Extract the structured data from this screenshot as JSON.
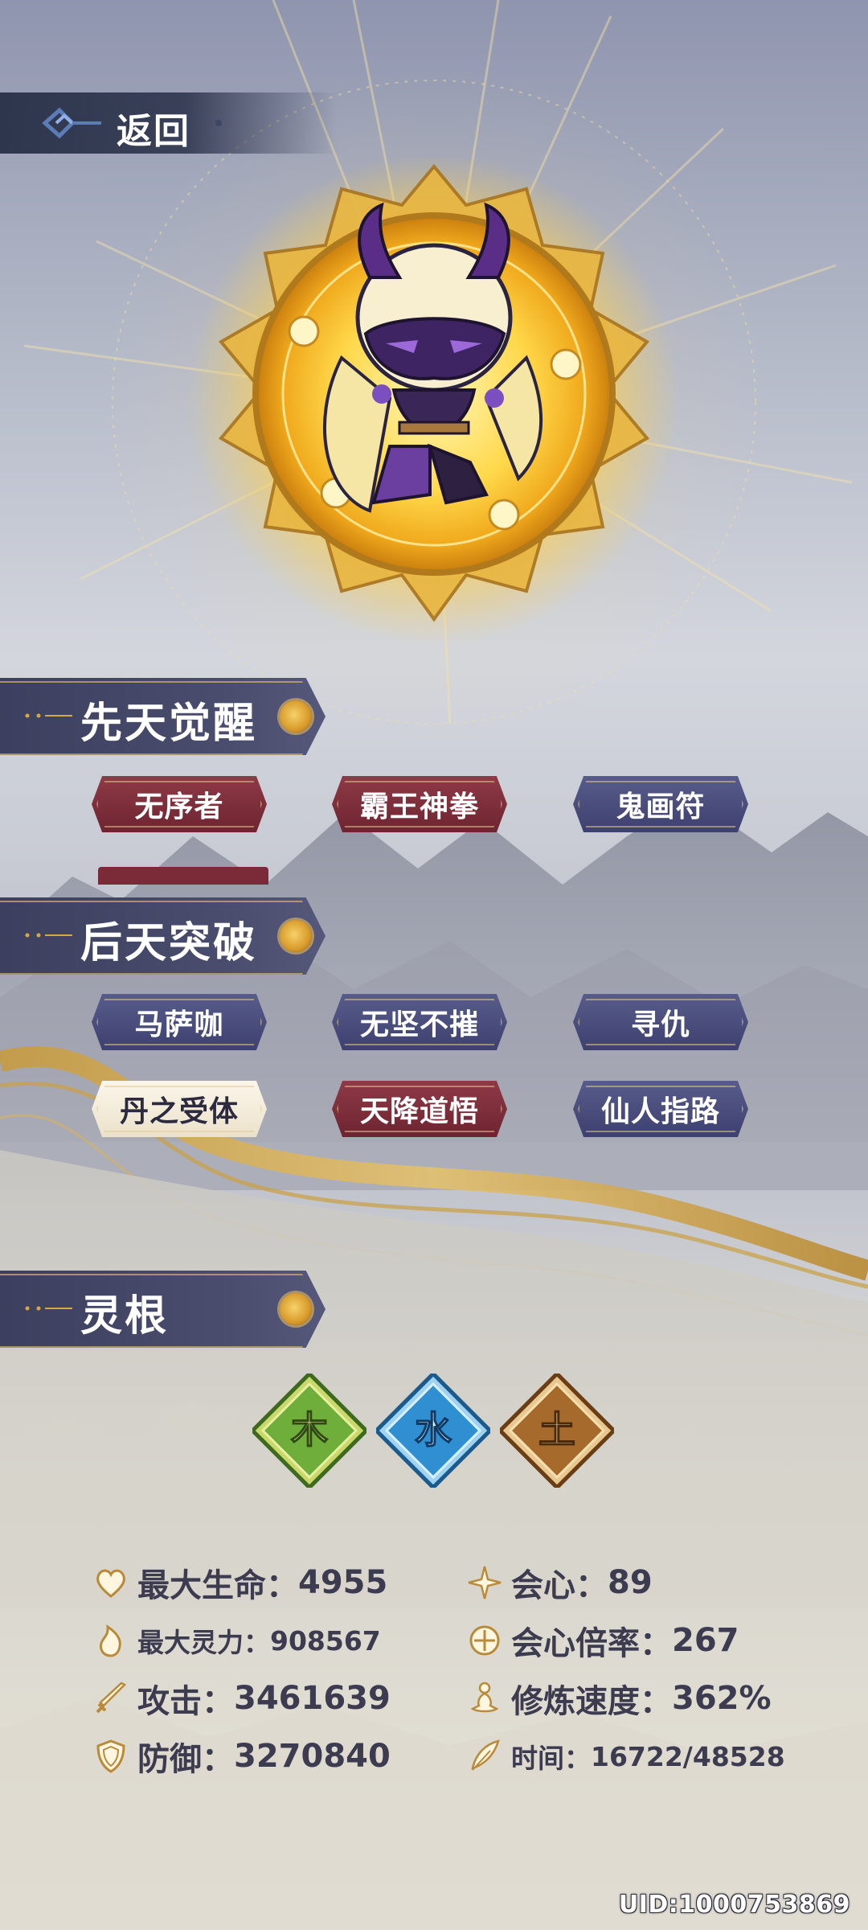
{
  "nav": {
    "back_label": "返回"
  },
  "sections": {
    "innate": {
      "title": "先天觉醒",
      "tags": [
        {
          "label": "无序者",
          "style": "red"
        },
        {
          "label": "霸王神拳",
          "style": "red"
        },
        {
          "label": "鬼画符",
          "style": "blue"
        }
      ]
    },
    "acquired": {
      "title": "后天突破",
      "tags": [
        {
          "label": "马萨咖",
          "style": "blue"
        },
        {
          "label": "无坚不摧",
          "style": "blue"
        },
        {
          "label": "寻仇",
          "style": "blue"
        },
        {
          "label": "丹之受体",
          "style": "light"
        },
        {
          "label": "天降道悟",
          "style": "red"
        },
        {
          "label": "仙人指路",
          "style": "blue"
        }
      ]
    },
    "spirit_root": {
      "title": "灵根",
      "roots": [
        {
          "glyph": "木",
          "icon": "wood-element-icon",
          "color": "#6fae3a"
        },
        {
          "glyph": "水",
          "icon": "water-element-icon",
          "color": "#2f8fd0"
        },
        {
          "glyph": "土",
          "icon": "earth-element-icon",
          "color": "#a56a2c"
        }
      ]
    }
  },
  "stats": [
    {
      "label": "最大生命：",
      "value": "4955",
      "icon": "heart-icon"
    },
    {
      "label": "会心：",
      "value": "89",
      "icon": "spark-icon"
    },
    {
      "label": "最大灵力：",
      "value": "908567",
      "icon": "flame-icon"
    },
    {
      "label": "会心倍率：",
      "value": "267",
      "icon": "crit-rate-icon"
    },
    {
      "label": "攻击：",
      "value": "3461639",
      "icon": "sword-icon"
    },
    {
      "label": "修炼速度：",
      "value": "362%",
      "icon": "meditation-icon"
    },
    {
      "label": "防御：",
      "value": "3270840",
      "icon": "shield-icon"
    },
    {
      "label": "时间：",
      "value": "16722/48528",
      "icon": "feather-icon"
    }
  ],
  "uid_text": "UID:1000753869",
  "colors": {
    "header_plate": "#3c3f5e",
    "tag_red": "#7b2b38",
    "tag_blue": "#4a4d7c",
    "gold": "#d6a84a",
    "text_dark": "#3d3b50"
  }
}
